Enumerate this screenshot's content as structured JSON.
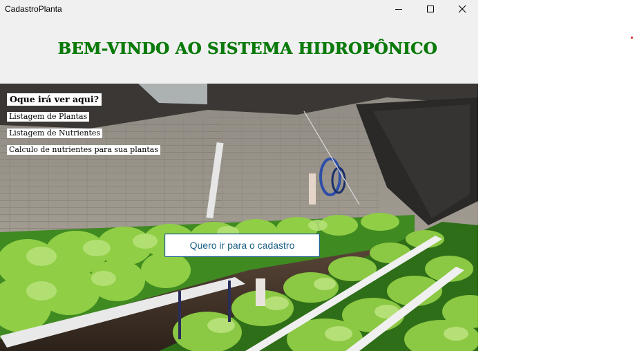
{
  "window": {
    "title": "CadastroPlanta",
    "controls": [
      "minimize-icon",
      "maximize-icon",
      "close-icon"
    ]
  },
  "header": {
    "title": "BEM-VINDO AO SISTEMA HIDROPÔNICO",
    "title_color": "#0a7a0a"
  },
  "info": {
    "heading": "Oque irá ver aqui?",
    "items": [
      {
        "label": "Listagem de Plantas"
      },
      {
        "label": "Listagem de Nutrientes"
      },
      {
        "label": "Calculo de nutrientes para sua plantas"
      }
    ]
  },
  "cta": {
    "label": "Quero ir para o cadastro",
    "accent": "#1b5f86"
  },
  "background": {
    "image": "hydroponic greenhouse with lettuce rows"
  }
}
